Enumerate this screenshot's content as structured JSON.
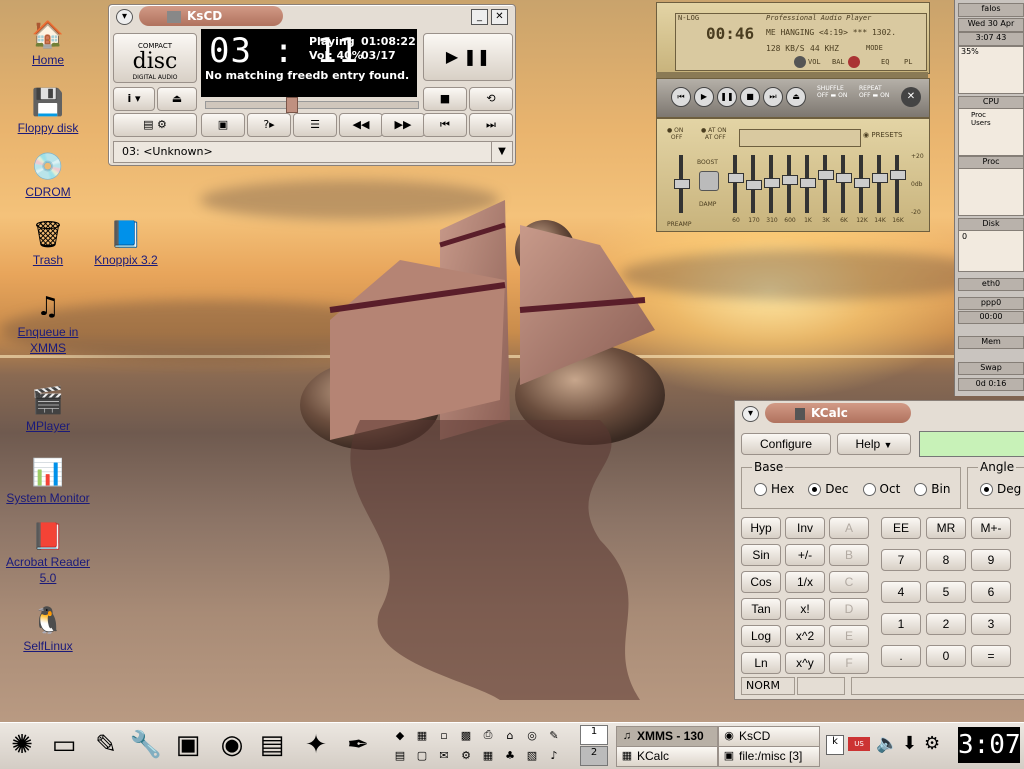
{
  "desktop_icons": [
    {
      "label": "Home",
      "icon": "home-folder-icon"
    },
    {
      "label": "Floppy disk",
      "icon": "floppy-icon"
    },
    {
      "label": "CDROM",
      "icon": "cdrom-icon"
    },
    {
      "label": "Trash",
      "icon": "trash-icon"
    },
    {
      "label": "Knoppix  3.2",
      "icon": "knoppix-icon"
    },
    {
      "label": "Enqueue in XMMS",
      "icon": "xmms-enqueue-icon"
    },
    {
      "label": "MPlayer",
      "icon": "mplayer-icon"
    },
    {
      "label": "System Monitor",
      "icon": "system-monitor-icon"
    },
    {
      "label": "Acrobat Reader 5.0",
      "icon": "acrobat-icon"
    },
    {
      "label": "SelfLinux",
      "icon": "tux-icon"
    }
  ],
  "kscd": {
    "title": "KsCD",
    "logo_top": "COMPACT",
    "logo_mid": "disc",
    "logo_bot": "DIGITAL AUDIO",
    "time": "03 : 11",
    "status": "Playing",
    "total_time": "01:08:22",
    "volume": "Vol: 40%",
    "track_count": "03/17",
    "message": "No matching freedb entry found.",
    "track_select": "03: <Unknown>",
    "volume_slider_fraction": 0.4
  },
  "xmms": {
    "nlog": "N-LOG",
    "brand": "Professional Audio Player",
    "time": "00:46",
    "song": "ME HANGING  <4:19>  *** 1302.",
    "bitrate": "128 KB/S",
    "rate": "44 KHZ",
    "mode": "MODE",
    "vol": "VOL",
    "bal": "BAL",
    "eq_label": "EQ",
    "pl_label": "PL",
    "shuffle": "SHUFFLE",
    "repeat": "REPEAT",
    "off": "OFF",
    "on": "ON",
    "eq_on": "ON",
    "eq_off": "OFF",
    "auto_on": "AT ON",
    "auto_off": "AT OFF",
    "presets": "PRESETS",
    "boost": "BOOST",
    "damp": "DAMP",
    "preamp": "PREAMP",
    "db_top": "+20",
    "db_mid": "0db",
    "db_bot": "-20",
    "bands": [
      "60",
      "170",
      "310",
      "600",
      "1K",
      "3K",
      "6K",
      "12K",
      "14K",
      "16K"
    ]
  },
  "gkrellm": {
    "host": "falos",
    "date": "Wed 30 Apr",
    "time": "3:07",
    "seconds": "43",
    "cpu_label": "CPU",
    "cpu_text": "Proc",
    "proc_label": "Proc",
    "disk_label": "Disk",
    "disk_value": "0",
    "eth_label": "eth0",
    "ppp_label": "ppp0",
    "ppp_time": "00:00",
    "mem_label": "Mem",
    "swap_label": "Swap",
    "uptime": "0d 0:16",
    "cpu_top": "35%",
    "proc_users": "Users"
  },
  "kcalc": {
    "title": "KCalc",
    "configure": "Configure",
    "help": "Help",
    "display": "",
    "base_label": "Base",
    "bases": [
      "Hex",
      "Dec",
      "Oct",
      "Bin"
    ],
    "base_selected": "Dec",
    "angle_label": "Angle",
    "angle_selected": "Deg",
    "func_rows": [
      [
        "Hyp",
        "Inv",
        "A"
      ],
      [
        "Sin",
        "+/-",
        "B"
      ],
      [
        "Cos",
        "1/x",
        "C"
      ],
      [
        "Tan",
        "x!",
        "D"
      ],
      [
        "Log",
        "x^2",
        "E"
      ],
      [
        "Ln",
        "x^y",
        "F"
      ]
    ],
    "num_rows": [
      [
        "EE",
        "MR",
        "M+-"
      ],
      [
        "7",
        "8",
        "9"
      ],
      [
        "4",
        "5",
        "6"
      ],
      [
        "1",
        "2",
        "3"
      ],
      [
        ".",
        "0",
        "="
      ]
    ],
    "status": "NORM"
  },
  "taskbar": {
    "pager": [
      "1",
      "2"
    ],
    "tasks": [
      {
        "label": "XMMS - 130",
        "active": true
      },
      {
        "label": "KsCD",
        "active": false
      },
      {
        "label": "KCalc",
        "active": false
      },
      {
        "label": "file:/misc [3]",
        "active": false
      }
    ],
    "clock": "3:07"
  },
  "colors": {
    "kcalc_display": "#c8f2b8",
    "title_pill": "#b7786a"
  }
}
